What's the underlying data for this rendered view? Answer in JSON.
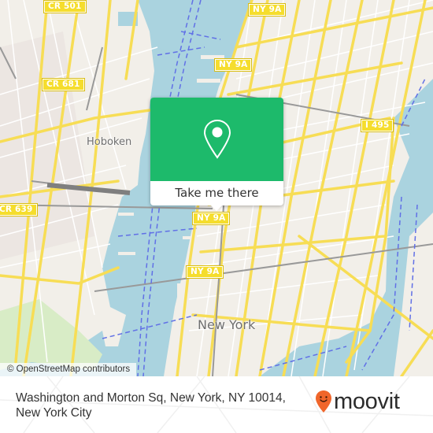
{
  "map": {
    "attribution": "© OpenStreetMap contributors",
    "colors": {
      "land": "#f2efe9",
      "water": "#aad3df",
      "road_major": "#f7dd55",
      "road_minor": "#ffffff",
      "rail": "#999999",
      "ferry": "#6170e6",
      "park": "#c8e6b0"
    },
    "shields": [
      {
        "id": "cr501",
        "label": "CR 501"
      },
      {
        "id": "cr681",
        "label": "CR 681"
      },
      {
        "id": "cr639",
        "label": "CR 639"
      },
      {
        "id": "ny9a-top",
        "label": "NY 9A"
      },
      {
        "id": "ny9a-mid",
        "label": "NY 9A"
      },
      {
        "id": "ny9a-pin",
        "label": "NY 9A"
      },
      {
        "id": "ny9a-low",
        "label": "NY 9A"
      },
      {
        "id": "i495",
        "label": "I 495"
      }
    ],
    "places": [
      {
        "id": "hoboken",
        "label": "Hoboken"
      },
      {
        "id": "new-york",
        "label": "New York"
      }
    ]
  },
  "popup": {
    "icon": "map-pin-icon",
    "button_label": "Take me there",
    "accent_color": "#1dba6b"
  },
  "footer": {
    "address_line1": "Washington and Morton Sq, New York, NY 10014,",
    "address_line2": "New York City",
    "brand": {
      "name": "moovit",
      "icon": "moovit-pin-smile-icon",
      "color": "#f0662b"
    }
  }
}
